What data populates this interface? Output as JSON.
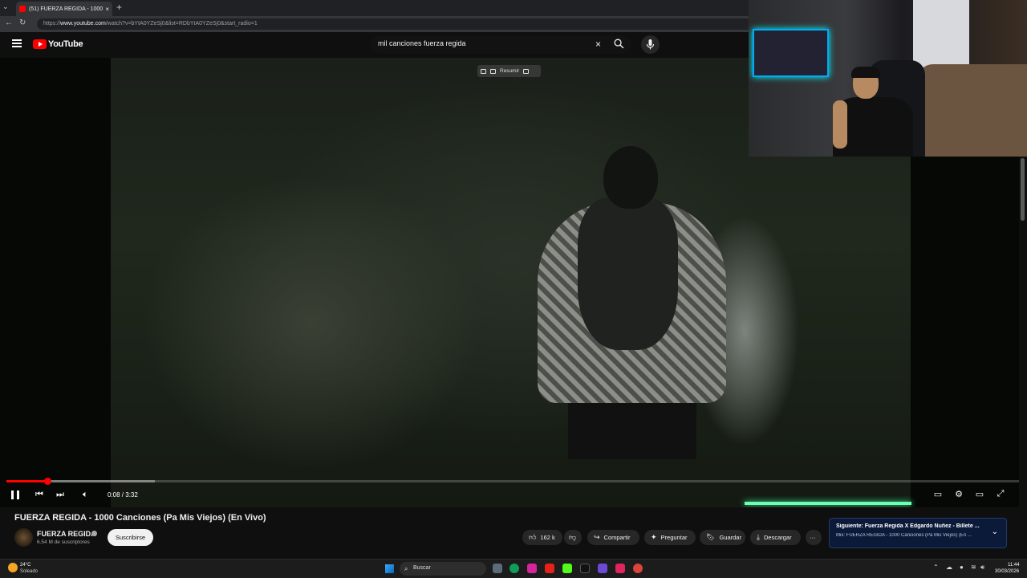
{
  "browser": {
    "tab_title": "(51) FUERZA REGIDA - 1000 C",
    "tab_close": "×",
    "new_tab": "+",
    "url_prefix": "https://",
    "url_host": "www.youtube.com",
    "url_path": "/watch?v=bYtA0YZeSj0&list=RDbYtA0YZeSj0&start_radio=1"
  },
  "youtube": {
    "logo_text": "YouTube",
    "search_value": "mil canciones fuerza regida",
    "search_clear": "×"
  },
  "overlay": {
    "summarize_label": "Resumir"
  },
  "player": {
    "time": "0:08 / 3:32",
    "progress": 0.04,
    "buffered": 0.146
  },
  "video": {
    "title": "FUERZA REGIDA - 1000 Canciones (Pa Mis Viejos) (En Vivo)",
    "channel": "FUERZA REGIDA",
    "subscribers": "6.54 M de suscriptores",
    "subscribe_label": "Suscribirse",
    "likes": "162 k",
    "share_label": "Compartir",
    "ask_label": "Preguntar",
    "save_label": "Guardar",
    "download_label": "Descargar",
    "more_label": "···"
  },
  "next_up": {
    "title": "Siguiente: Fuerza Regida X Edgardo Nuñez - Billete ...",
    "subtitle": "Mix: FUERZA REGIDA - 1000 Canciones (Pa Mis Viejos) (En ..."
  },
  "taskbar": {
    "temperature": "24°C",
    "weather": "Soleado",
    "search_label": "Buscar",
    "time": "11:44",
    "date": "30/03/2026"
  },
  "colors": {
    "youtube_red": "#ff0000",
    "background": "#0f0f0f",
    "next_card": "#0c1a3a"
  }
}
